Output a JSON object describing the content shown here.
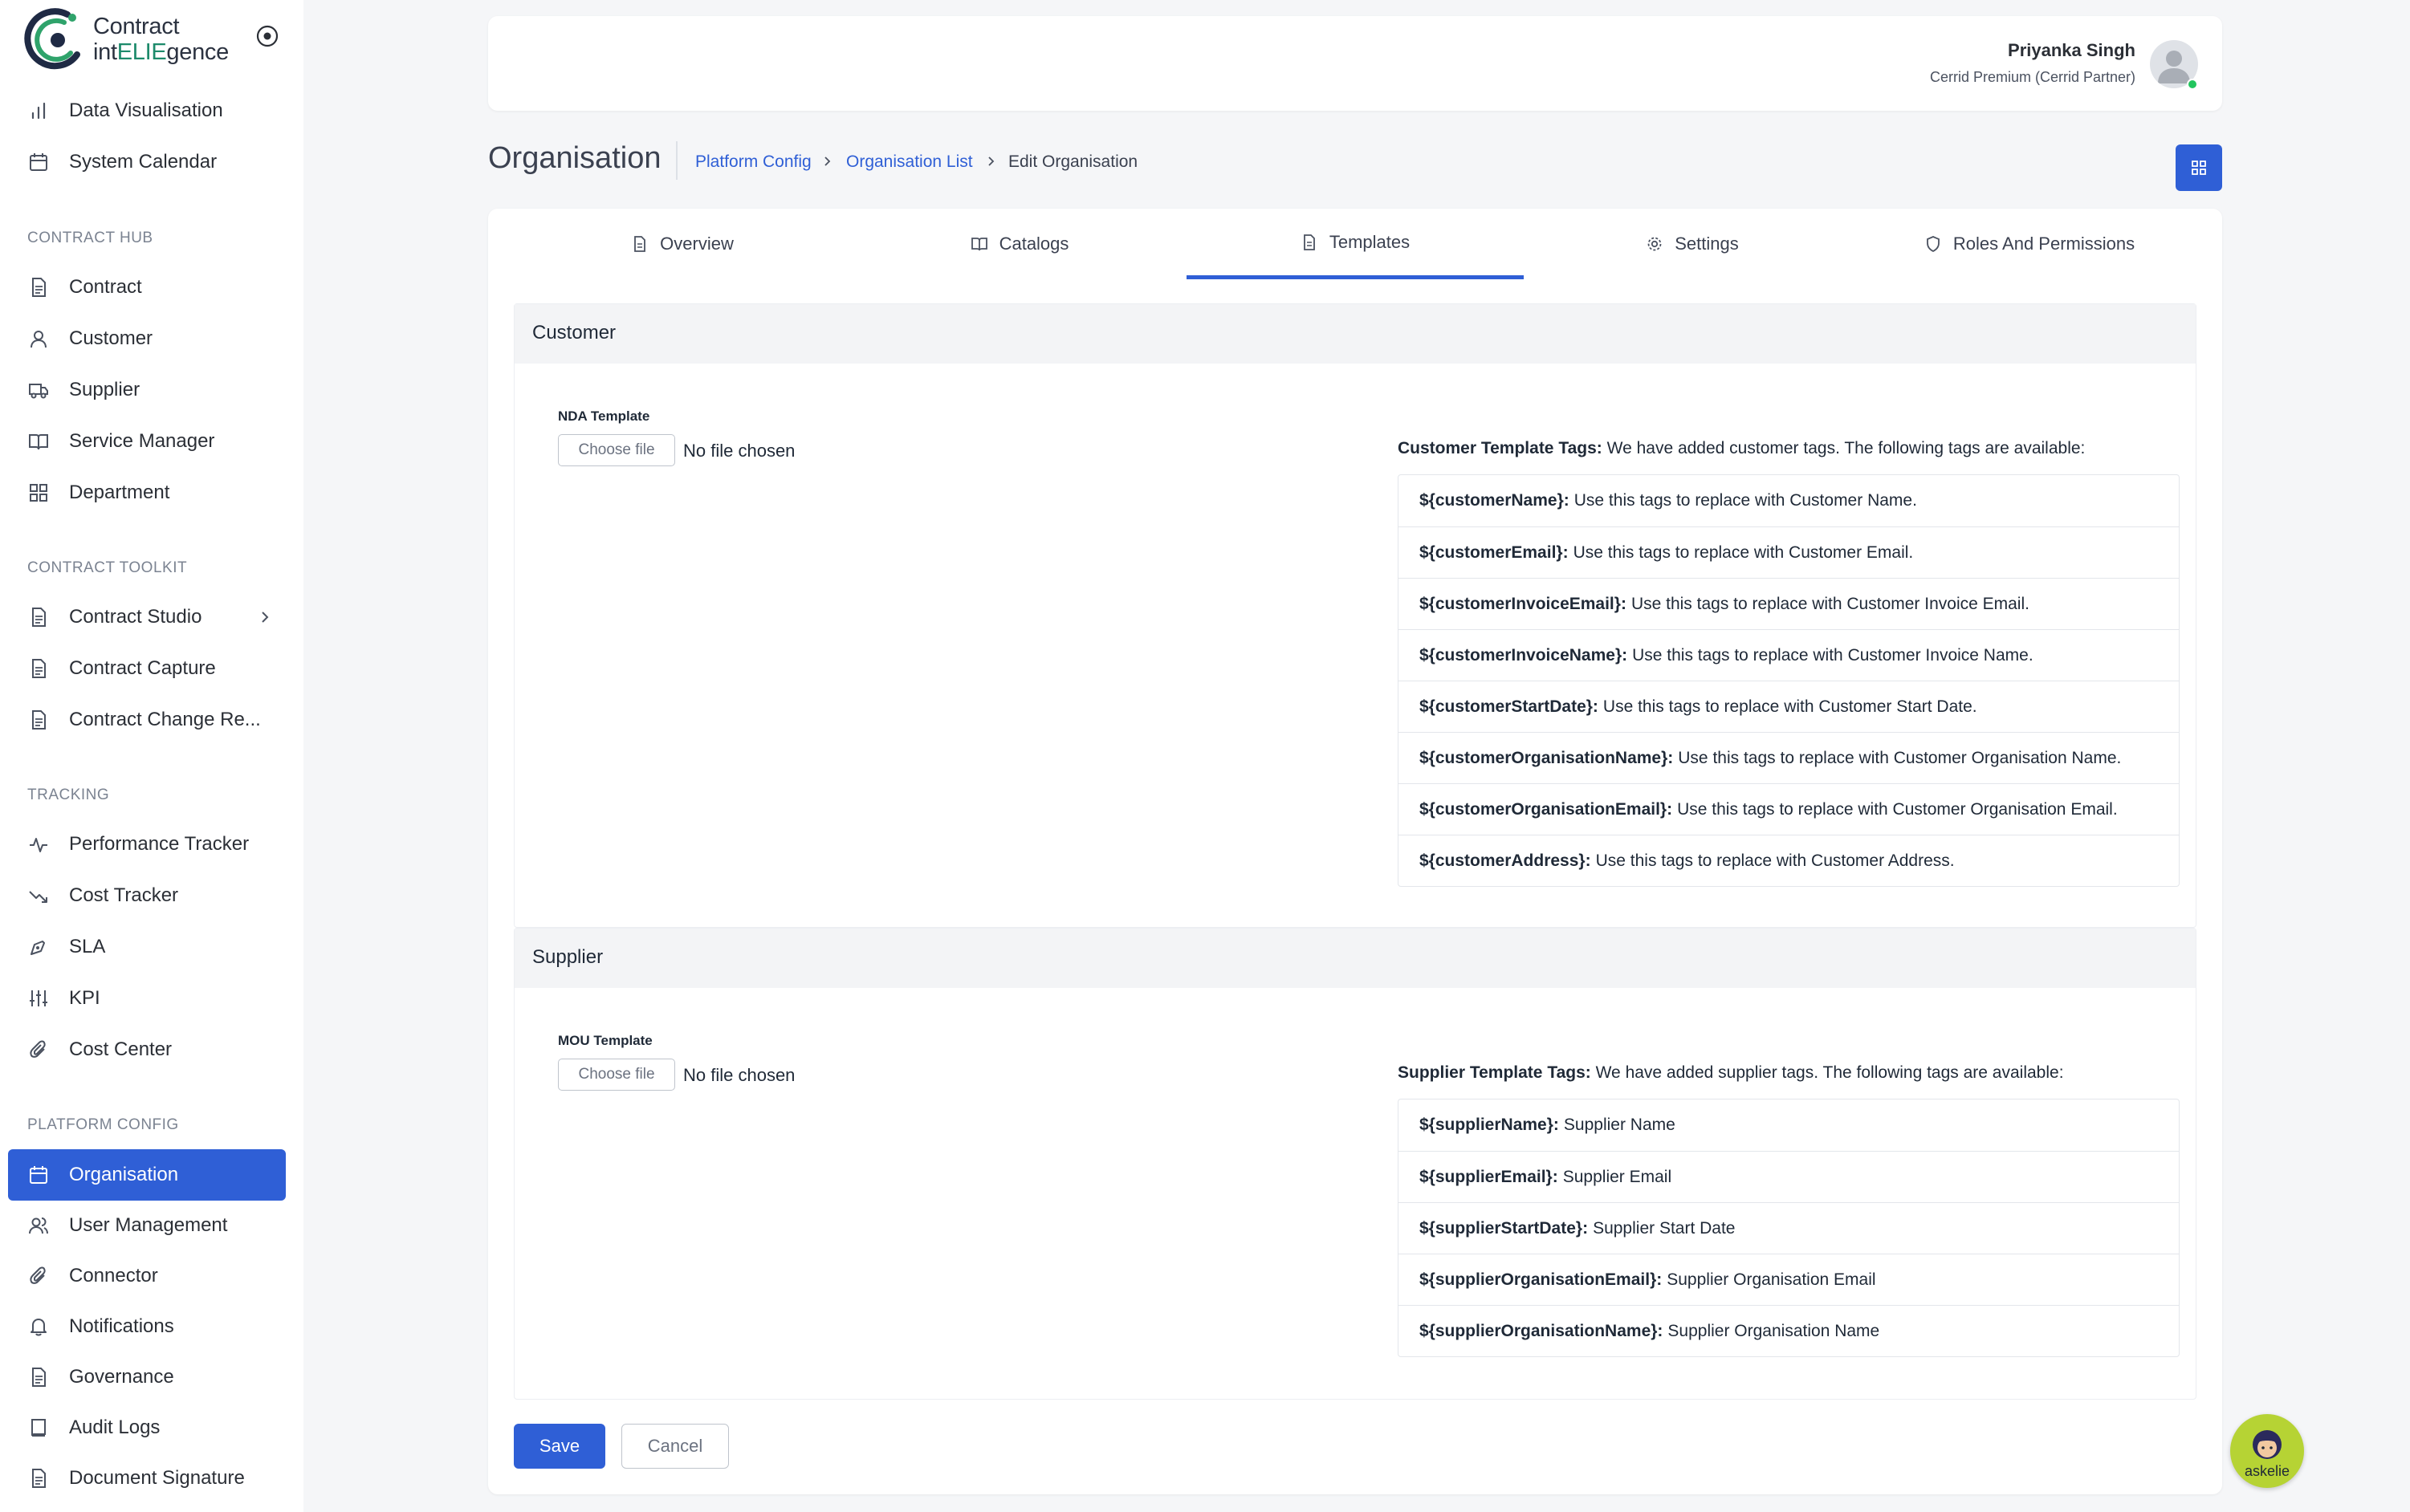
{
  "app": {
    "name_line1": "Contract",
    "name_line2_pre": "int",
    "name_line2_hl": "ELIE",
    "name_line2_post": "gence"
  },
  "sidebar": {
    "top_items": [
      {
        "label": "Data Visualisation",
        "icon": "bar-chart-icon"
      },
      {
        "label": "System Calendar",
        "icon": "calendar-icon"
      }
    ],
    "sections": [
      {
        "title": "CONTRACT HUB",
        "items": [
          {
            "label": "Contract",
            "icon": "document-icon"
          },
          {
            "label": "Customer",
            "icon": "user-icon"
          },
          {
            "label": "Supplier",
            "icon": "truck-icon"
          },
          {
            "label": "Service Manager",
            "icon": "book-icon"
          },
          {
            "label": "Department",
            "icon": "grid-icon"
          }
        ]
      },
      {
        "title": "CONTRACT TOOLKIT",
        "items": [
          {
            "label": "Contract Studio",
            "icon": "document-icon"
          },
          {
            "label": "Contract Capture",
            "icon": "document-icon"
          },
          {
            "label": "Contract Change Re...",
            "icon": "document-icon"
          }
        ]
      },
      {
        "title": "TRACKING",
        "items": [
          {
            "label": "Performance Tracker",
            "icon": "activity-icon"
          },
          {
            "label": "Cost Tracker",
            "icon": "trending-down-icon"
          },
          {
            "label": "SLA",
            "icon": "pen-tool-icon"
          },
          {
            "label": "KPI",
            "icon": "sliders-icon"
          },
          {
            "label": "Cost Center",
            "icon": "paperclip-icon"
          }
        ]
      },
      {
        "title": "PLATFORM CONFIG",
        "items": [
          {
            "label": "Organisation",
            "icon": "calendar-icon",
            "active": true
          },
          {
            "label": "User Management",
            "icon": "users-icon"
          },
          {
            "label": "Connector",
            "icon": "paperclip-icon"
          },
          {
            "label": "Notifications",
            "icon": "bell-icon"
          },
          {
            "label": "Governance",
            "icon": "document-icon"
          },
          {
            "label": "Audit Logs",
            "icon": "book-icon"
          },
          {
            "label": "Document Signature",
            "icon": "document-icon"
          }
        ]
      }
    ]
  },
  "header": {
    "user_name": "Priyanka Singh",
    "user_role": "Cerrid Premium (Cerrid Partner)"
  },
  "page": {
    "title": "Organisation",
    "breadcrumbs": [
      {
        "label": "Platform Config",
        "link": true
      },
      {
        "label": "Organisation List",
        "link": true
      },
      {
        "label": "Edit Organisation",
        "link": false
      }
    ]
  },
  "tabs": [
    {
      "label": "Overview",
      "icon": "document-icon"
    },
    {
      "label": "Catalogs",
      "icon": "book-open-icon"
    },
    {
      "label": "Templates",
      "icon": "document-icon",
      "active": true
    },
    {
      "label": "Settings",
      "icon": "gear-icon"
    },
    {
      "label": "Roles And Permissions",
      "icon": "shield-icon"
    }
  ],
  "customer": {
    "section_title": "Customer",
    "field_label": "NDA Template",
    "file_button": "Choose file",
    "file_status": "No file chosen",
    "tags_intro_bold": "Customer Template Tags:",
    "tags_intro_text": "We have added customer tags. The following tags are available:",
    "tags": [
      {
        "tag": "${customerName}:",
        "desc": "Use this tags to replace with Customer Name."
      },
      {
        "tag": "${customerEmail}:",
        "desc": "Use this tags to replace with Customer Email."
      },
      {
        "tag": "${customerInvoiceEmail}:",
        "desc": "Use this tags to replace with Customer Invoice Email."
      },
      {
        "tag": "${customerInvoiceName}:",
        "desc": "Use this tags to replace with Customer Invoice Name."
      },
      {
        "tag": "${customerStartDate}:",
        "desc": "Use this tags to replace with Customer Start Date."
      },
      {
        "tag": "${customerOrganisationName}:",
        "desc": "Use this tags to replace with Customer Organisation Name."
      },
      {
        "tag": "${customerOrganisationEmail}:",
        "desc": "Use this tags to replace with Customer Organisation Email."
      },
      {
        "tag": "${customerAddress}:",
        "desc": "Use this tags to replace with Customer Address."
      }
    ]
  },
  "supplier": {
    "section_title": "Supplier",
    "field_label": "MOU Template",
    "file_button": "Choose file",
    "file_status": "No file chosen",
    "tags_intro_bold": "Supplier Template Tags:",
    "tags_intro_text": "We have added supplier tags. The following tags are available:",
    "tags": [
      {
        "tag": "${supplierName}:",
        "desc": "Supplier Name"
      },
      {
        "tag": "${supplierEmail}:",
        "desc": "Supplier Email"
      },
      {
        "tag": "${supplierStartDate}:",
        "desc": "Supplier Start Date"
      },
      {
        "tag": "${supplierOrganisationEmail}:",
        "desc": "Supplier Organisation Email"
      },
      {
        "tag": "${supplierOrganisationName}:",
        "desc": "Supplier Organisation Name"
      }
    ]
  },
  "actions": {
    "save": "Save",
    "cancel": "Cancel"
  },
  "assistant": {
    "label": "askelie"
  },
  "colors": {
    "primary": "#2f5fd6",
    "brand_green": "#1d8a6b",
    "online": "#22c55e",
    "assistant_bg": "#b6d334"
  }
}
